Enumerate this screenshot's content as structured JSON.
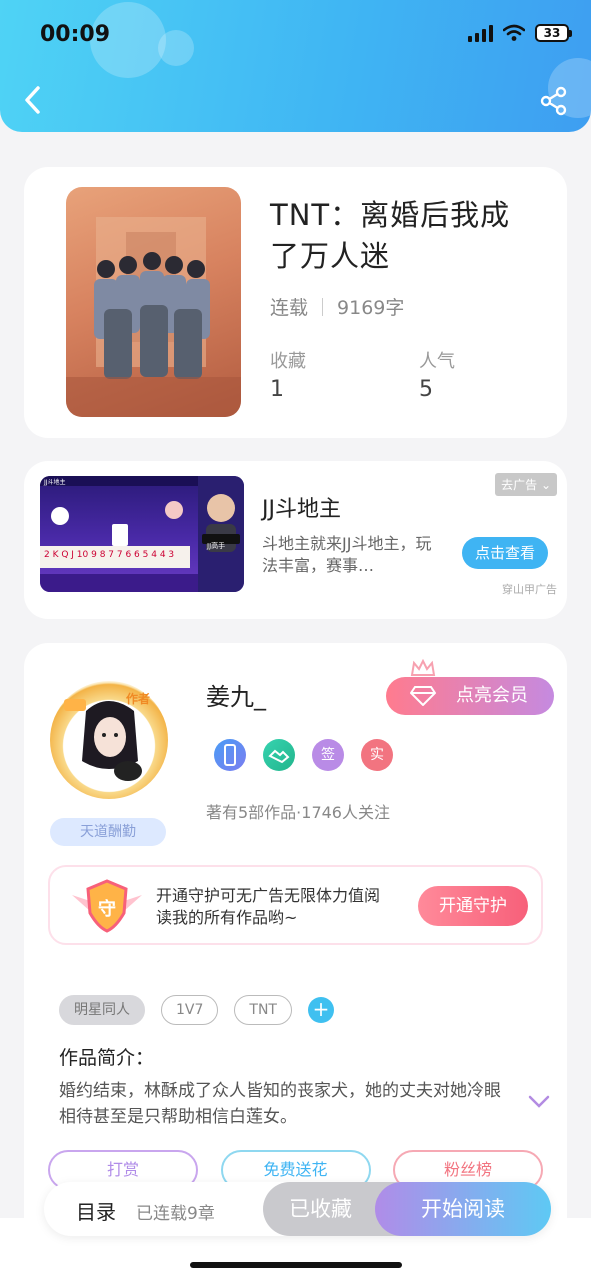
{
  "status": {
    "time": "00:09",
    "battery": "33"
  },
  "book": {
    "title": "TNT：离婚后我成了万人迷",
    "status": "连载",
    "word_count": "9169字",
    "favorites_label": "收藏",
    "favorites_value": "1",
    "popularity_label": "人气",
    "popularity_value": "5"
  },
  "ad": {
    "title": "JJ斗地主",
    "description": "斗地主就来JJ斗地主，玩法丰富，赛事…",
    "close_label": "去广告 ⌄",
    "button_label": "点击查看",
    "source": "穿山甲广告",
    "game_tag": "JJ斗地主",
    "host_tag": "JJ高手"
  },
  "author": {
    "name": "姜九_",
    "avatar_badge": "作者",
    "title_tag": "天道酬勤",
    "vip_button": "点亮会员",
    "badges": [
      "签",
      "实"
    ],
    "stats": "著有5部作品·1746人关注"
  },
  "guard": {
    "icon_char": "守",
    "text": "开通守护可无广告无限体力值阅读我的所有作品哟~",
    "button": "开通守护"
  },
  "tags": [
    "明星同人",
    "1V7",
    "TNT"
  ],
  "intro": {
    "label": "作品简介：",
    "text": "婚约结束，林酥成了众人皆知的丧家犬，她的丈夫对她冷眼相待甚至是只帮助相信白莲女。"
  },
  "actions": [
    "打赏",
    "免费送花",
    "粉丝榜"
  ],
  "bottom": {
    "toc": "目录",
    "chapters": "已连载9章",
    "collected": "已收藏",
    "read": "开始阅读"
  },
  "colors": {
    "accent": "#3fb4f3",
    "vip": "#ff7b8e",
    "guard": "#f7607a"
  }
}
